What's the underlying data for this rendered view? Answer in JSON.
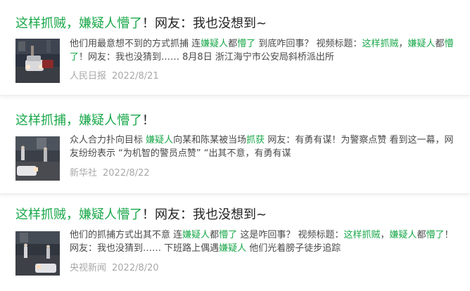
{
  "results": [
    {
      "title": {
        "hl1": "这样抓贼",
        "sep1": "，",
        "hl2": "嫌疑人懵了",
        "rest": "！网友：我也没想到~"
      },
      "summary": [
        {
          "t": "他们用最意想不到的方式抓捕 连",
          "hl": false
        },
        {
          "t": "嫌疑人",
          "hl": true
        },
        {
          "t": "都",
          "hl": false
        },
        {
          "t": "懵了",
          "hl": true
        },
        {
          "t": " 到底咋回事？ 视频标题：",
          "hl": false
        },
        {
          "t": "这样抓贼",
          "hl": true
        },
        {
          "t": "，",
          "hl": false
        },
        {
          "t": "嫌疑人",
          "hl": true
        },
        {
          "t": "都",
          "hl": false
        },
        {
          "t": "懵了",
          "hl": true
        },
        {
          "t": "！网友：我也没猜到…… 8月8日 浙江海宁市公安局斜桥派出所",
          "hl": false
        }
      ],
      "source": "人民日报",
      "date": "2022/8/21",
      "thumbnail_icon": "night-street-car-thumbnail"
    },
    {
      "title": {
        "hl1": "这样抓捕",
        "sep1": "，",
        "hl2": "嫌疑人懵了",
        "rest": "！"
      },
      "summary": [
        {
          "t": "众人合力扑向目标 ",
          "hl": false
        },
        {
          "t": "嫌疑人",
          "hl": true
        },
        {
          "t": "向某和陈某被当场",
          "hl": false
        },
        {
          "t": "抓获",
          "hl": true
        },
        {
          "t": " 网友：有勇有谋！为警察点赞 看到这一幕，网友纷纷表示 “为机智的警员点赞” “出其不意，有勇有谋",
          "hl": false
        }
      ],
      "source": "新华社",
      "date": "2022/8/22",
      "thumbnail_icon": "night-street-arrest-thumbnail"
    },
    {
      "title": {
        "hl1": "这样抓贼",
        "sep1": "，",
        "hl2": "嫌疑人懵了",
        "rest": "！网友：我也没想到~"
      },
      "summary": [
        {
          "t": "他们的抓捕方式出其不意 连",
          "hl": false
        },
        {
          "t": "嫌疑人",
          "hl": true
        },
        {
          "t": "都",
          "hl": false
        },
        {
          "t": "懵了",
          "hl": true
        },
        {
          "t": " 这是咋回事？ 视频标题：",
          "hl": false
        },
        {
          "t": "这样抓贼",
          "hl": true
        },
        {
          "t": "，",
          "hl": false
        },
        {
          "t": "嫌疑人",
          "hl": true
        },
        {
          "t": "都",
          "hl": false
        },
        {
          "t": "懵了",
          "hl": true
        },
        {
          "t": "！网友：我也没猜到…… 下班路上偶遇",
          "hl": false
        },
        {
          "t": "嫌疑人",
          "hl": true
        },
        {
          "t": " 他们光着膀子徒步追踪",
          "hl": false
        }
      ],
      "source": "央视新闻",
      "date": "2022/8/20",
      "thumbnail_icon": "night-street-chase-thumbnail"
    }
  ],
  "colors": {
    "highlight": "#1aa84a",
    "title_text": "#222222",
    "summary_text": "#4a4a4a",
    "meta_text": "#a8a8a8"
  }
}
